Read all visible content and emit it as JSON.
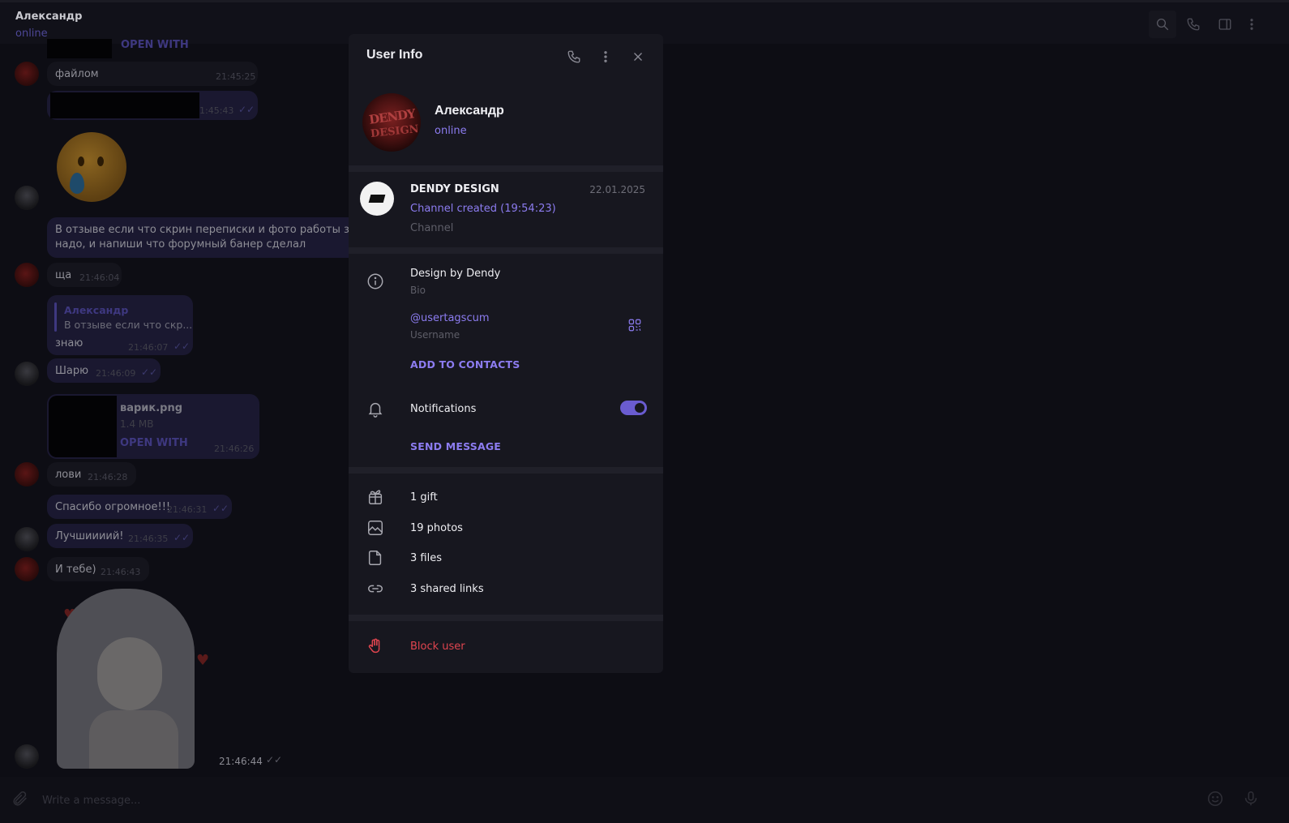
{
  "header": {
    "peer_name": "Александр",
    "peer_status": "online",
    "icons": [
      "search-icon",
      "phone-icon",
      "sidebar-icon",
      "more-icon"
    ]
  },
  "chat": {
    "messages": [
      {
        "id": "m0",
        "type": "file-partial",
        "link": "OPEN WITH"
      },
      {
        "id": "m1",
        "from": "Александр",
        "text": "файлом",
        "time": "21:45:25"
      },
      {
        "id": "m2",
        "from": "me",
        "text": "",
        "time": "1:45:43",
        "hidden_prefix": true
      },
      {
        "id": "m3",
        "from": "me",
        "type": "emoji",
        "emoji": "crying-smile-emoji"
      },
      {
        "id": "m4",
        "from": "me",
        "text1": "В отзыве если что скрин переписки и фото работы закинут",
        "text2": "надо, и напиши что форумный банер сделал"
      },
      {
        "id": "m5",
        "from": "Александр",
        "text": "ща",
        "time": "21:46:04"
      },
      {
        "id": "m6",
        "from": "me",
        "reply_name": "Александр",
        "reply_text": "В отзыве если что скр...",
        "text": "знаю",
        "time": "21:46:07"
      },
      {
        "id": "m7",
        "from": "me",
        "text": "Шарю",
        "time": "21:46:09"
      },
      {
        "id": "m8",
        "from": "me",
        "type": "file",
        "file_name": "варик.png",
        "file_size": "1.4 MB",
        "link": "OPEN WITH",
        "time": "21:46:26"
      },
      {
        "id": "m9",
        "from": "Александр",
        "text": "лови",
        "time": "21:46:28"
      },
      {
        "id": "m10",
        "from": "me",
        "text": "Спасибо огромное!!!",
        "time": "21:46:31"
      },
      {
        "id": "m11",
        "from": "me",
        "text": "Лучшиииий!",
        "time": "21:46:35"
      },
      {
        "id": "m12",
        "from": "Александр",
        "text": "И тебе)",
        "time": "21:46:43"
      },
      {
        "id": "m13",
        "from": "me",
        "type": "sticker",
        "time": "21:46:44"
      }
    ]
  },
  "composer": {
    "placeholder": "Write a message...",
    "icons": [
      "attach-icon",
      "emoji-icon",
      "microphone-icon"
    ]
  },
  "panel": {
    "title": "User Info",
    "user": {
      "name": "Александр",
      "status": "online"
    },
    "avatar_text": [
      "DENDY",
      "DESIGN"
    ],
    "channel": {
      "name": "DENDY DESIGN",
      "date": "22.01.2025",
      "last_post": "Channel created (19:54:23)",
      "type": "Channel"
    },
    "bio": {
      "value": "Design by Dendy",
      "label": "Bio"
    },
    "username": {
      "value": "@usertagscum",
      "label": "Username"
    },
    "add_contact": "ADD TO CONTACTS",
    "notifications": {
      "label": "Notifications",
      "enabled": true
    },
    "send_message": "SEND MESSAGE",
    "media": [
      {
        "icon": "gift-icon",
        "label": "1 gift"
      },
      {
        "icon": "photo-icon",
        "label": "19 photos"
      },
      {
        "icon": "file-icon",
        "label": "3 files"
      },
      {
        "icon": "link-icon",
        "label": "3 shared links"
      }
    ],
    "block": "Block user"
  },
  "colors": {
    "accent": "#8c7cf0",
    "danger": "#e0454f",
    "panel_bg": "#17171f"
  }
}
